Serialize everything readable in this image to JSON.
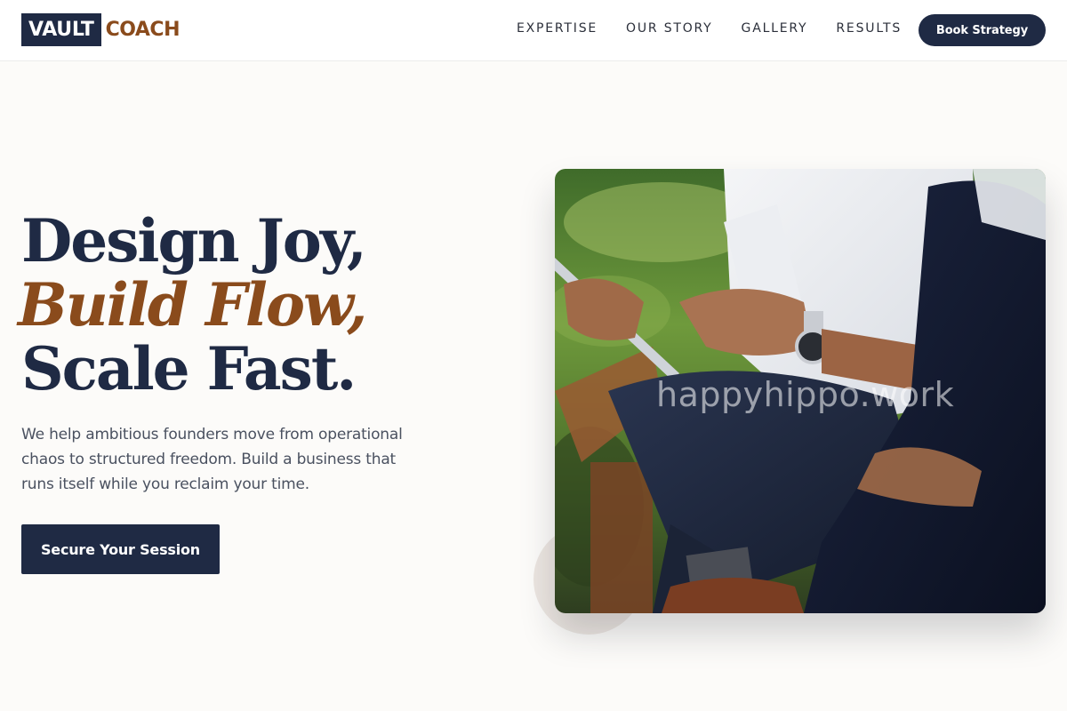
{
  "header": {
    "logo_primary": "VAULT",
    "logo_secondary": "COACH",
    "nav": [
      "EXPERTISE",
      "OUR STORY",
      "GALLERY",
      "RESULTS"
    ],
    "cta": "Book Strategy"
  },
  "hero": {
    "line1": "Design Joy,",
    "line2": "Build Flow,",
    "line3": "Scale Fast.",
    "subtext": "We help ambitious founders move from operational chaos to structured freedom. Build a business that runs itself while you reclaim your time.",
    "cta": "Secure Your Session"
  },
  "photo": {
    "watermark": "happyhippo.work"
  },
  "colors": {
    "navy": "#1f2a44",
    "accent_brown": "#8a4b1c",
    "background": "#fcfbf9"
  }
}
